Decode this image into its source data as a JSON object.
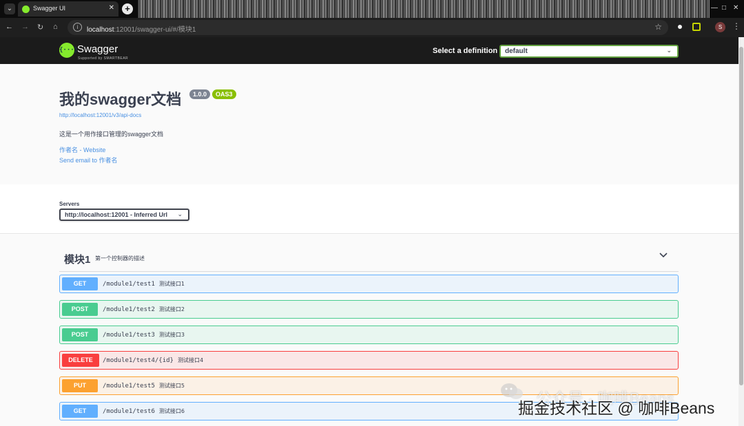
{
  "browser": {
    "tab_title": "Swagger UI",
    "tab_close": "✕",
    "new_tab": "+",
    "url_host": "localhost",
    "url_rest": ":12001/swagger-ui/#/模块1"
  },
  "topbar": {
    "logo_mark": "{···}",
    "logo_text": "Swagger",
    "logo_sub": "Supported by SMARTBEAR",
    "definition_label": "Select a definition",
    "definition_value": "default"
  },
  "info": {
    "title": "我的swagger文档",
    "version": "1.0.0",
    "oas": "OAS3",
    "api_docs_url": "http://localhost:12001/v3/api-docs",
    "description": "这是一个用作接口管理的swagger文档",
    "contact_link": "作者名 - Website",
    "email_link": "Send email to 作者名"
  },
  "servers": {
    "label": "Servers",
    "selected": "http://localhost:12001 - Inferred Url"
  },
  "tag": {
    "name": "模块1",
    "description": "第一个控制器的描述"
  },
  "operations": [
    {
      "method": "GET",
      "path": "/module1/test1",
      "summary": "测试接口1"
    },
    {
      "method": "POST",
      "path": "/module1/test2",
      "summary": "测试接口2"
    },
    {
      "method": "POST",
      "path": "/module1/test3",
      "summary": "测试接口3"
    },
    {
      "method": "DELETE",
      "path": "/module1/test4/{id}",
      "summary": "测试接口4"
    },
    {
      "method": "PUT",
      "path": "/module1/test5",
      "summary": "测试接口5"
    },
    {
      "method": "GET",
      "path": "/module1/test6",
      "summary": "测试接口6"
    }
  ],
  "watermark": {
    "line1": "公众号 · 咖啡Beans",
    "line2": "掘金技术社区 @ 咖啡Beans"
  },
  "colors": {
    "get": "#61affe",
    "post": "#49cc90",
    "delete": "#f93e3e",
    "put": "#fca130",
    "swagger_green": "#85ea2d"
  }
}
